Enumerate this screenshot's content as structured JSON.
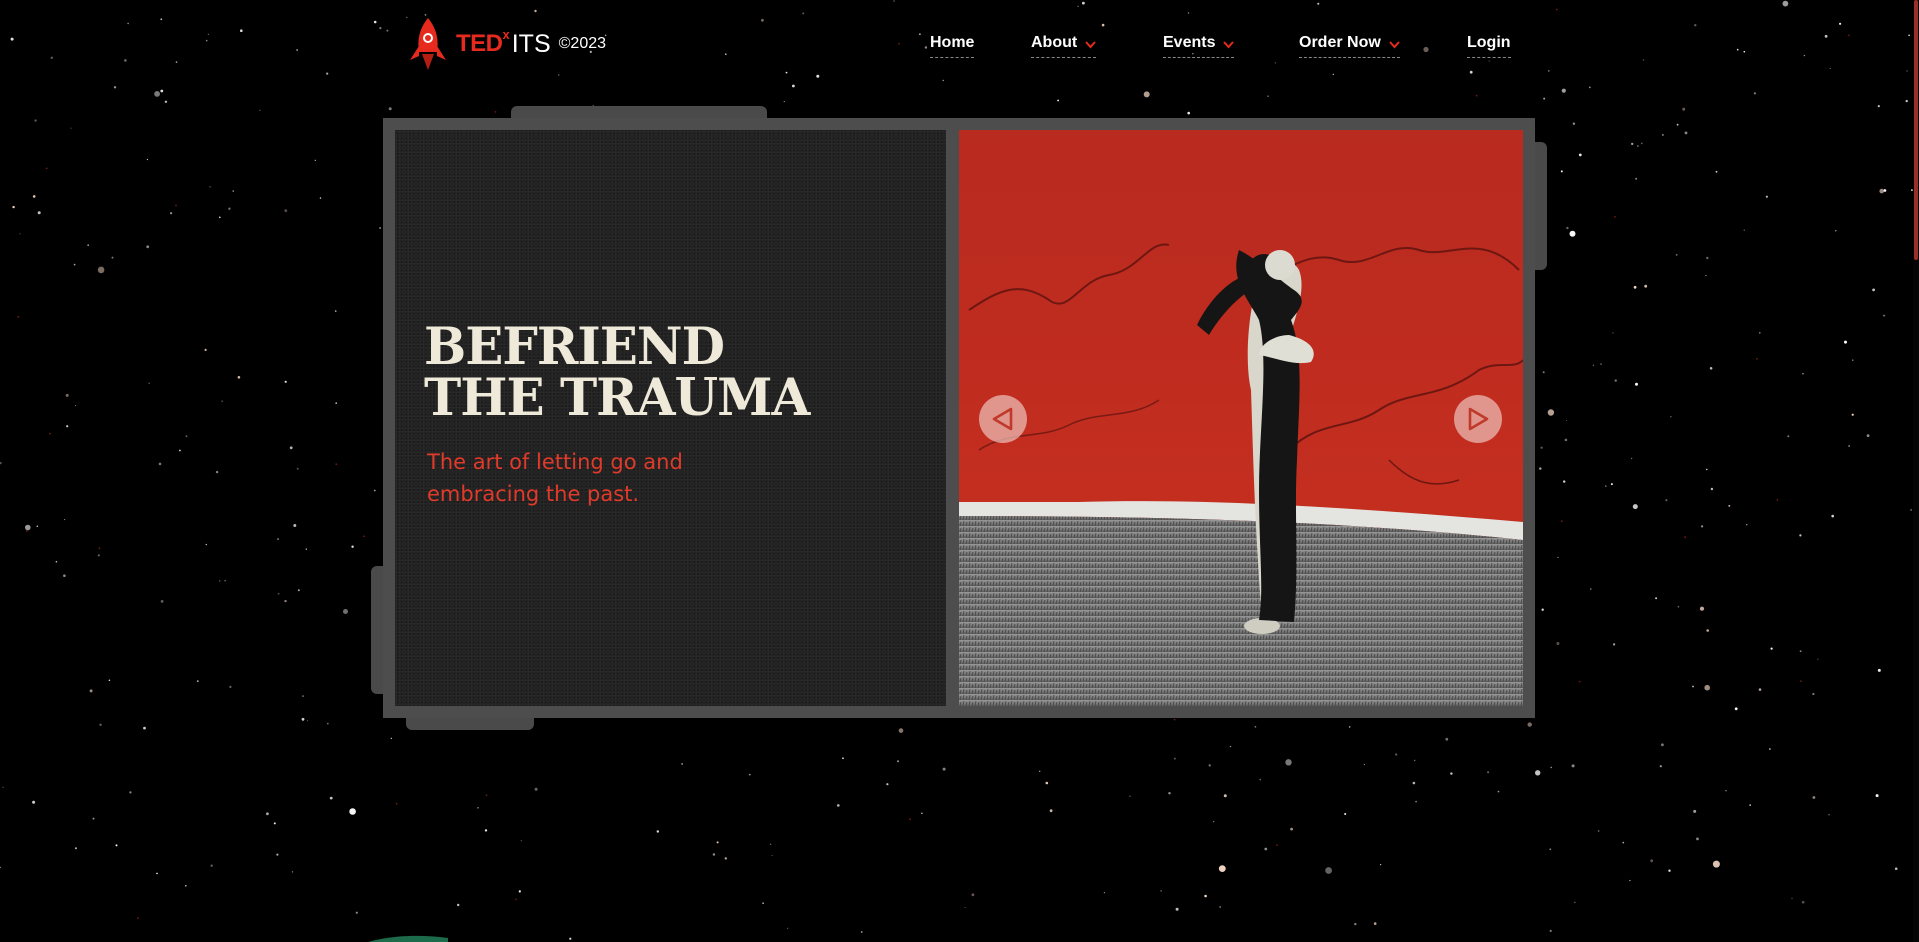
{
  "logo": {
    "ted": "TED",
    "x": "x",
    "its": "ITS",
    "year": "©2023"
  },
  "nav": {
    "items": [
      {
        "label": "Home",
        "dropdown": false
      },
      {
        "label": "About",
        "dropdown": true
      },
      {
        "label": "Events",
        "dropdown": true
      },
      {
        "label": "Order Now",
        "dropdown": true
      },
      {
        "label": "Login",
        "dropdown": false
      }
    ]
  },
  "hero": {
    "title": "BEFRIEND\nTHE TRAUMA",
    "subtitle": "The art of letting go and embracing the past.",
    "prev_icon": "triangle-left-icon",
    "next_icon": "triangle-right-icon"
  },
  "colors": {
    "accent": "#e62b1e",
    "headline": "#efe9d9",
    "frame": "#4d4d4d",
    "panel": "#222222",
    "art_red": "#c22a1f"
  }
}
